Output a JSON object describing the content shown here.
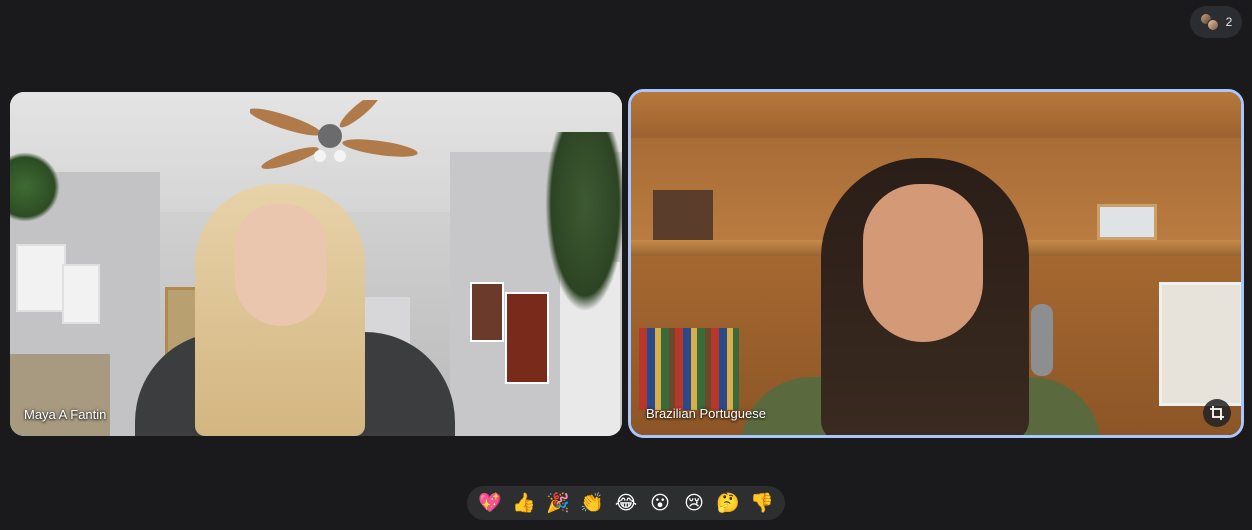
{
  "people_pill": {
    "count": "2",
    "icon": "participants-avatars-icon"
  },
  "tiles": [
    {
      "name": "Maya A Fantin"
    },
    {
      "name": "Brazilian Portuguese",
      "pinned_action_icon": "crop-frame-icon",
      "highlight_color": "#a8c7fa"
    }
  ],
  "reactions": [
    {
      "emoji": "💖",
      "name": "sparkling-heart-reaction"
    },
    {
      "emoji": "👍",
      "name": "thumbs-up-reaction"
    },
    {
      "emoji": "🎉",
      "name": "party-popper-reaction"
    },
    {
      "emoji": "👏",
      "name": "clapping-hands-reaction"
    },
    {
      "emoji": "😂",
      "name": "tears-of-joy-reaction"
    },
    {
      "emoji": "😮",
      "name": "surprised-face-reaction"
    },
    {
      "emoji": "😢",
      "name": "crying-face-reaction"
    },
    {
      "emoji": "🤔",
      "name": "thinking-face-reaction"
    },
    {
      "emoji": "👎",
      "name": "thumbs-down-reaction"
    }
  ],
  "colors": {
    "background": "#1a1a1c",
    "pill": "#2c2d30",
    "reaction_bar": "#2d2e30",
    "active_border": "#a8c7fa"
  }
}
